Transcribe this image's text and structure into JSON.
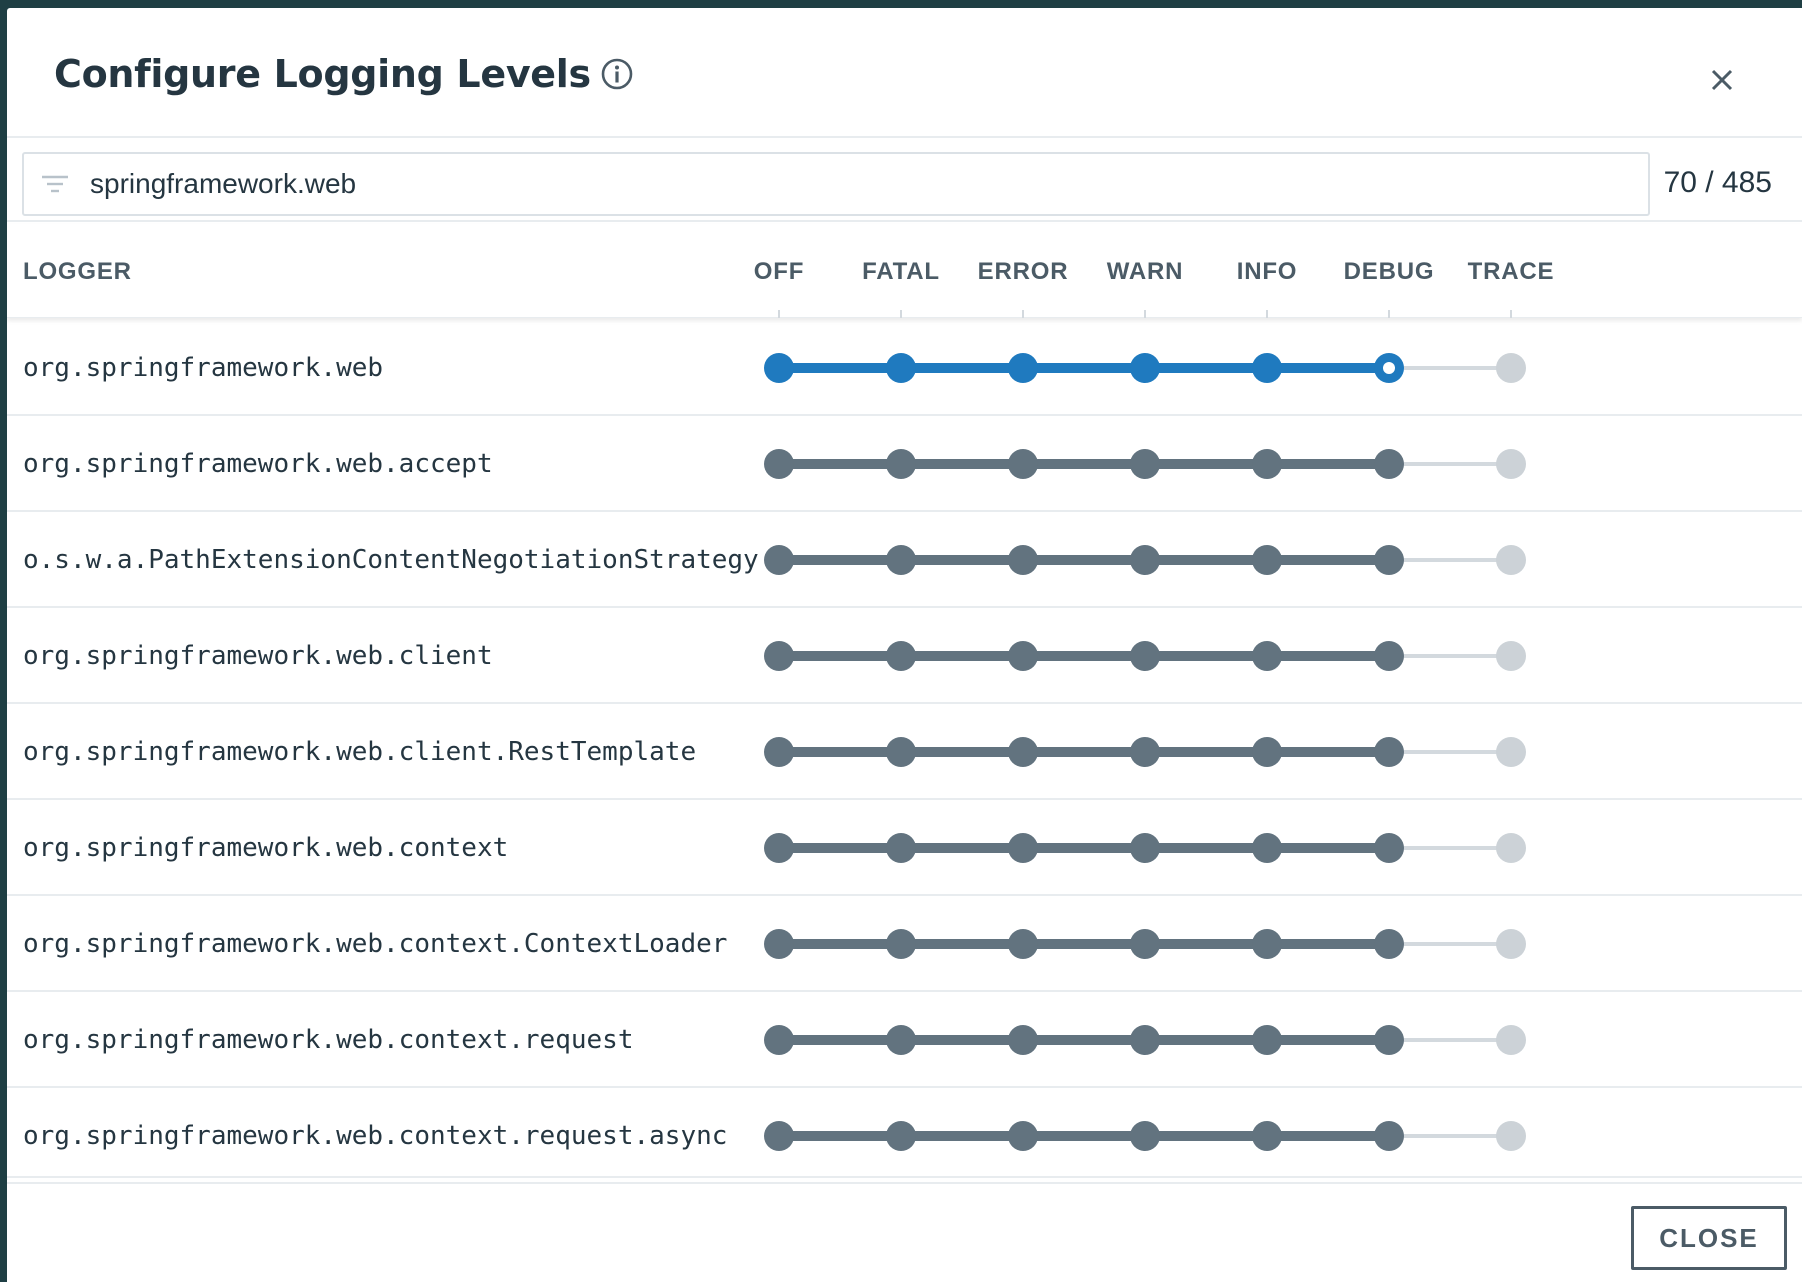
{
  "dialog": {
    "title": "Configure Logging Levels",
    "info_icon": "info-circle-icon",
    "close_icon": "close-x-icon"
  },
  "filter": {
    "icon": "filter-lines-icon",
    "value": "springframework.web",
    "placeholder": "",
    "count": "70 / 485"
  },
  "table": {
    "logger_header": "LOGGER",
    "levels": [
      "OFF",
      "FATAL",
      "ERROR",
      "WARN",
      "INFO",
      "DEBUG",
      "TRACE"
    ],
    "rows": [
      {
        "name": "org.springframework.web",
        "level": "DEBUG",
        "explicit": true
      },
      {
        "name": "org.springframework.web.accept",
        "level": "DEBUG",
        "explicit": false
      },
      {
        "name": "o.s.w.a.PathExtensionContentNegotiationStrategy",
        "level": "DEBUG",
        "explicit": false
      },
      {
        "name": "org.springframework.web.client",
        "level": "DEBUG",
        "explicit": false
      },
      {
        "name": "org.springframework.web.client.RestTemplate",
        "level": "DEBUG",
        "explicit": false
      },
      {
        "name": "org.springframework.web.context",
        "level": "DEBUG",
        "explicit": false
      },
      {
        "name": "org.springframework.web.context.ContextLoader",
        "level": "DEBUG",
        "explicit": false
      },
      {
        "name": "org.springframework.web.context.request",
        "level": "DEBUG",
        "explicit": false
      },
      {
        "name": "org.springframework.web.context.request.async",
        "level": "DEBUG",
        "explicit": false
      }
    ]
  },
  "footer": {
    "close_label": "CLOSE"
  },
  "colors": {
    "active_blue": "#1f7abf",
    "inherited_gray": "#62737f",
    "inactive_light": "#ccd2d7",
    "text_dark": "#253641"
  }
}
